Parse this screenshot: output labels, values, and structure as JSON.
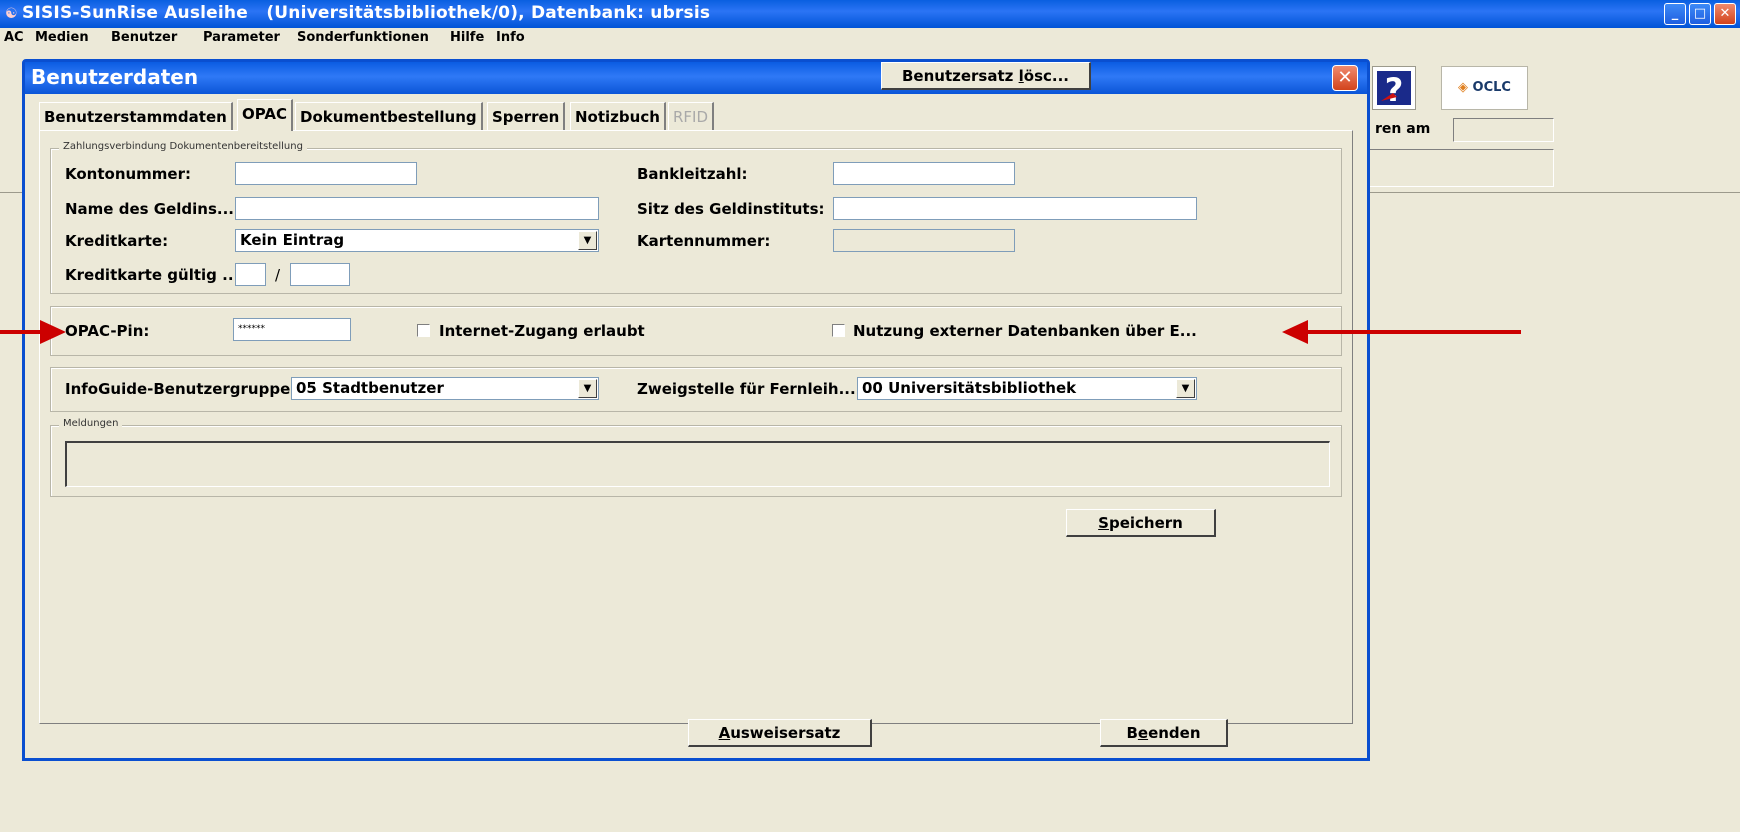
{
  "app": {
    "title": "SISIS-SunRise Ausleihe   (Universitätsbibliothek/0), Datenbank: ubrsis",
    "window_controls": {
      "minimize": "_",
      "maximize": "□",
      "close": "✕"
    },
    "menu": [
      "AC",
      "Medien",
      "Benutzer",
      "Parameter",
      "Sonderfunktionen",
      "Hilfe",
      "Info"
    ],
    "background": {
      "help_icon": "help-question-icon",
      "oclc_label": "OCLC",
      "ren_am_label": "ren am"
    }
  },
  "dialog": {
    "title": "Benutzerdaten",
    "close": "✕",
    "tabs": [
      {
        "label": "Benutzerstammdaten",
        "state": "normal"
      },
      {
        "label": "OPAC",
        "state": "active"
      },
      {
        "label": "Dokumentbestellung",
        "state": "normal"
      },
      {
        "label": "Sperren",
        "state": "normal"
      },
      {
        "label": "Notizbuch",
        "state": "normal"
      },
      {
        "label": "RFID",
        "state": "disabled"
      }
    ],
    "payment_group": {
      "legend": "Zahlungsverbindung Dokumentenbereitstellung",
      "kontonummer_label": "Kontonummer:",
      "kontonummer_value": "",
      "bankleitzahl_label": "Bankleitzahl:",
      "bankleitzahl_value": "",
      "geldinstitut_name_label": "Name des Geldins...",
      "geldinstitut_name_value": "",
      "geldinstitut_sitz_label": "Sitz des Geldinstituts:",
      "geldinstitut_sitz_value": "",
      "kreditkarte_label": "Kreditkarte:",
      "kreditkarte_value": "Kein Eintrag",
      "kartennummer_label": "Kartennummer:",
      "kartennummer_value": "",
      "kreditkarte_gueltig_label": "Kreditkarte gültig ...",
      "gueltig_month": "",
      "gueltig_sep": "/",
      "gueltig_year": ""
    },
    "opac_group": {
      "pin_label": "OPAC-Pin:",
      "pin_value": "******",
      "internet_label": "Internet-Zugang erlaubt",
      "internet_checked": false,
      "extern_label": "Nutzung externer Datenbanken über E...",
      "extern_checked": false
    },
    "infoguide_group": {
      "gruppe_label": "InfoGuide-Benutzergruppe",
      "gruppe_value": "05 Stadtbenutzer",
      "zweigstelle_label": "Zweigstelle für Fernleih...",
      "zweigstelle_value": "00 Universitätsbibliothek"
    },
    "messages_group": {
      "legend": "Meldungen",
      "text": ""
    },
    "buttons": {
      "speichern": {
        "mnemonic": "S",
        "rest": "peichern"
      },
      "ausweisersatz": {
        "mnemonic": "A",
        "rest": "usweisersatz"
      },
      "benutzersatz": {
        "before": "Benutzersatz ",
        "mnemonic": "l",
        "rest": "ösc..."
      },
      "beenden": {
        "before": "B",
        "mnemonic": "e",
        "rest": "enden"
      }
    }
  },
  "annotations": {
    "arrow_color": "#cc0000"
  }
}
